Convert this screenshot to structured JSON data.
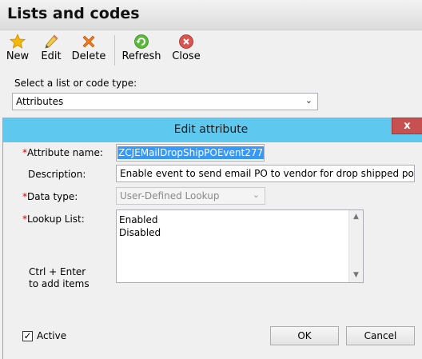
{
  "window": {
    "title": "Lists and codes"
  },
  "toolbar": {
    "new_label": "New",
    "edit_label": "Edit",
    "delete_label": "Delete",
    "refresh_label": "Refresh",
    "close_label": "Close"
  },
  "list_select": {
    "label": "Select a list or code type:",
    "value": "Attributes"
  },
  "dialog": {
    "title": "Edit attribute",
    "close_glyph": "x",
    "attribute_name_label": "Attribute name:",
    "attribute_name_value": "ZCJEMailDropShipPOEvent277",
    "description_label": "Description:",
    "description_value": "Enable event to send email PO to vendor for drop shipped po",
    "data_type_label": "Data type:",
    "data_type_value": "User-Defined Lookup",
    "lookup_list_label": "Lookup List:",
    "lookup_items": [
      "Enabled",
      "Disabled"
    ],
    "hint_line1": "Ctrl + Enter",
    "hint_line2": "to add items",
    "active_label": "Active",
    "active_checked": true,
    "ok_label": "OK",
    "cancel_label": "Cancel",
    "required_marker": "*"
  },
  "colors": {
    "dialog_title_bg": "#5ec8ee",
    "close_button_bg": "#c75050",
    "required_marker": "#d40000",
    "selection_highlight": "#3399ff"
  }
}
